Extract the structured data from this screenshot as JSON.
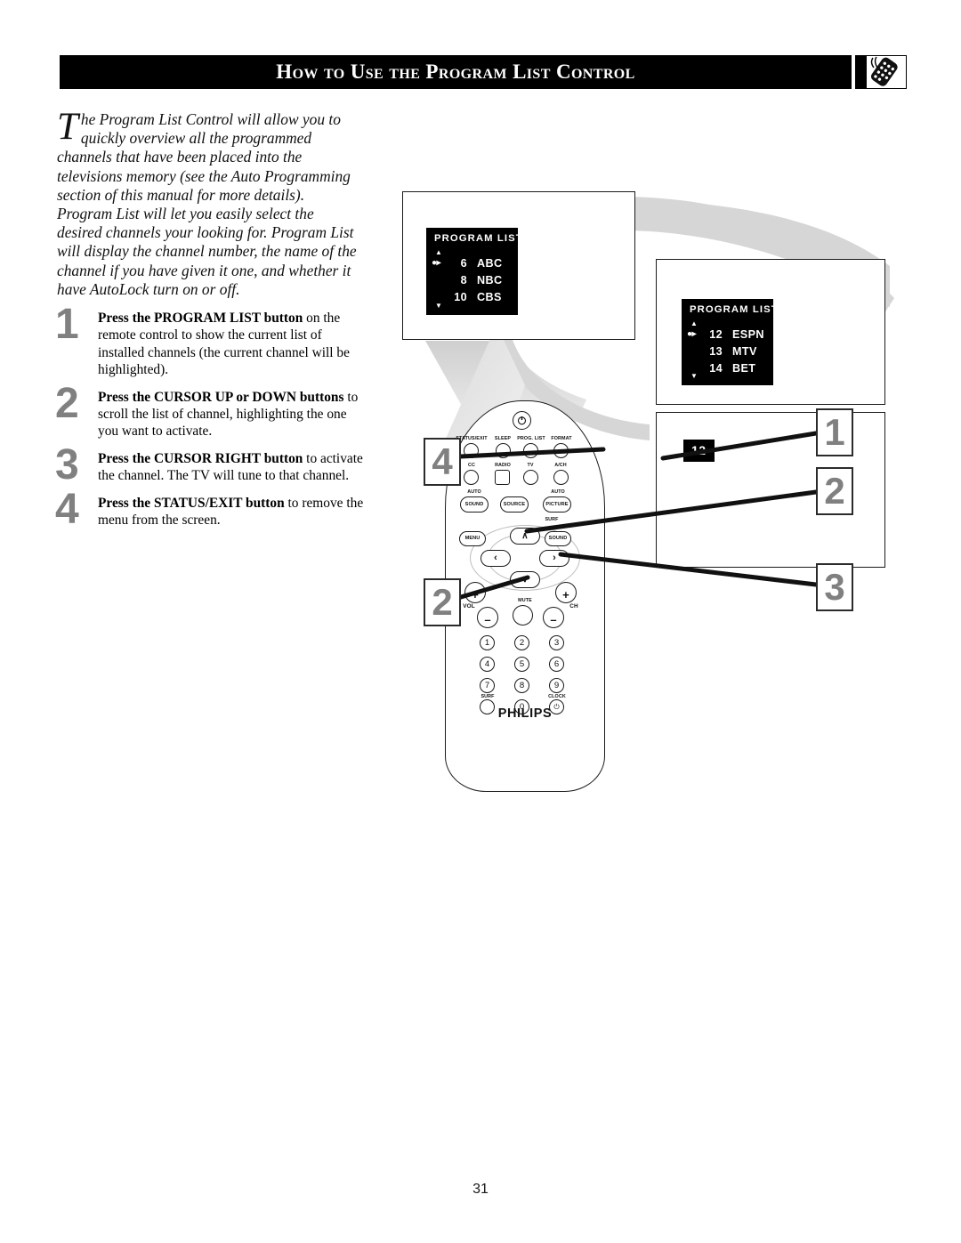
{
  "header": {
    "title": "How to Use the Program List Control",
    "icon": "remote-control-icon"
  },
  "intro": {
    "dropcap": "T",
    "text": "he Program List Control will allow you to quickly overview all the programmed channels that have been placed into the televisions memory (see the Auto Programming section of this manual for more details). Program List will let you easily select the desired channels your looking for. Program List will display the channel number, the name of the channel if you have given it one, and whether it have AutoLock turn on or off."
  },
  "steps": [
    {
      "number": "1",
      "bold": "Press the PROGRAM LIST button",
      "rest": " on the remote control to show the current list of installed channels (the current channel will be highlighted)."
    },
    {
      "number": "2",
      "bold": "Press the CURSOR UP or DOWN buttons",
      "rest": " to scroll the list of channel, highlighting the one you want to activate."
    },
    {
      "number": "3",
      "bold": "Press the CURSOR RIGHT button",
      "rest": " to activate the channel. The TV will tune to that channel."
    },
    {
      "number": "4",
      "bold": "Press the STATUS/EXIT button",
      "rest": " to remove the menu from the screen."
    }
  ],
  "screens": {
    "screen1": {
      "osd_title": "PROGRAM LIST",
      "scroll_up": "▲",
      "scroll_down": "▼",
      "rows": [
        {
          "marker": "●▸",
          "number": "6",
          "name": "ABC"
        },
        {
          "marker": "",
          "number": "8",
          "name": "NBC"
        },
        {
          "marker": "",
          "number": "10",
          "name": "CBS"
        }
      ]
    },
    "screen2": {
      "osd_title": "PROGRAM LIST",
      "scroll_up": "▲",
      "scroll_down": "▼",
      "rows": [
        {
          "marker": "●▸",
          "number": "12",
          "name": "ESPN"
        },
        {
          "marker": "",
          "number": "13",
          "name": "MTV"
        },
        {
          "marker": "",
          "number": "14",
          "name": "BET"
        }
      ]
    },
    "screen3": {
      "channel_badge": "12"
    }
  },
  "remote": {
    "brand": "PHILIPS",
    "power_label": "⏼",
    "row_top": [
      "STATUS/EXIT",
      "SLEEP",
      "PROG. LIST",
      "FORMAT"
    ],
    "row_second": [
      "CC",
      "RADIO",
      "TV",
      "A/CH"
    ],
    "row_third_over": [
      "AUTO",
      "",
      "AUTO"
    ],
    "row_third": [
      "SOUND",
      "SOURCE",
      "PICTURE"
    ],
    "pad_left": "MENU",
    "pad_right": "SOUND",
    "pad_top_over": "SURF",
    "cursor_up": "∧",
    "cursor_down": "∨",
    "cursor_left": "‹",
    "cursor_right": "›",
    "vol_label": "VOL",
    "ch_label": "CH",
    "mute_label": "MUTE",
    "plus": "+",
    "minus": "–",
    "keypad": [
      "1",
      "2",
      "3",
      "4",
      "5",
      "6",
      "7",
      "8",
      "9",
      "0"
    ],
    "surf_label": "SURF",
    "clock_label": "CLOCK"
  },
  "callouts": [
    {
      "id": "1",
      "label": "1"
    },
    {
      "id": "4",
      "label": "4"
    },
    {
      "id": "2a",
      "label": "2"
    },
    {
      "id": "2b",
      "label": "2"
    },
    {
      "id": "3",
      "label": "3"
    }
  ],
  "page_number": "31",
  "colors": {
    "header_bg": "#000000",
    "callout_num": "#808080",
    "osd_bg": "#000000",
    "beam_gray": "#d6d6d6"
  }
}
